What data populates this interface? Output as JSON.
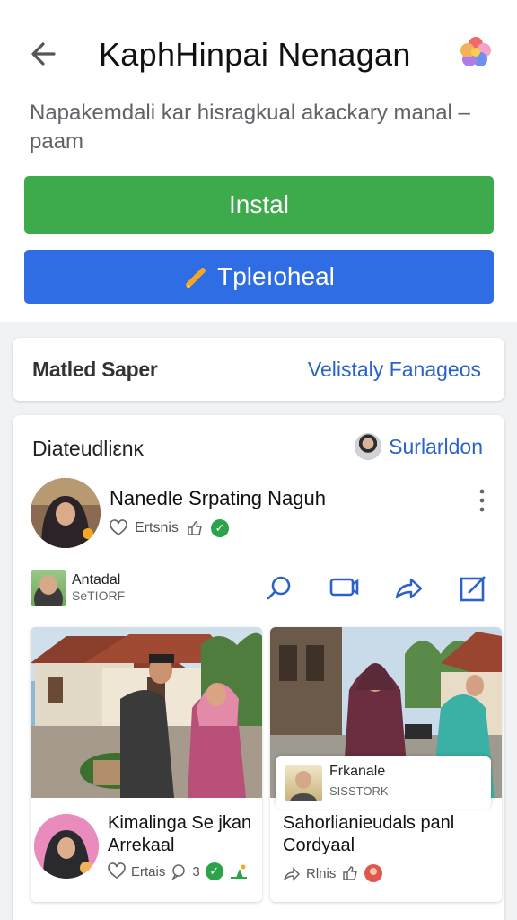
{
  "header": {
    "title": "KaphHinpai Nenagan",
    "description": "Napakemdali kar hisragkual akackary manal – paam"
  },
  "buttons": {
    "install_label": "Instal",
    "secondary_label": "Tpleıoheal"
  },
  "card_bar": {
    "left_label": "Matled Saper",
    "right_link": "Velistaly Fanageos"
  },
  "section": {
    "title": "Diateudliεnκ",
    "user_link": "Surlarldon"
  },
  "post": {
    "name": "Nanedle Srpating Naguh",
    "meta": "Ertsnis"
  },
  "row_user": {
    "name": "Antadal",
    "status": "SeTIORF"
  },
  "tiles": [
    {
      "title": "Kimalinga Se jkan Arrekaal",
      "meta_text": "Ertais",
      "count": "3"
    },
    {
      "title": "Sahorlianieudals panl Cordyaal",
      "meta_text": "Rlnis",
      "overlay_name": "Frkanale",
      "overlay_status": "SISSTORK"
    }
  ],
  "colors": {
    "install": "#3daa4b",
    "secondary": "#2f6de4",
    "link": "#2a62c9",
    "check": "#2aa34a"
  },
  "icons": [
    "back-arrow-icon",
    "flower-icon",
    "pencil-icon",
    "heart-icon",
    "check-icon",
    "search-icon",
    "comment-icon",
    "share-icon",
    "edit-icon",
    "kebab-icon"
  ]
}
